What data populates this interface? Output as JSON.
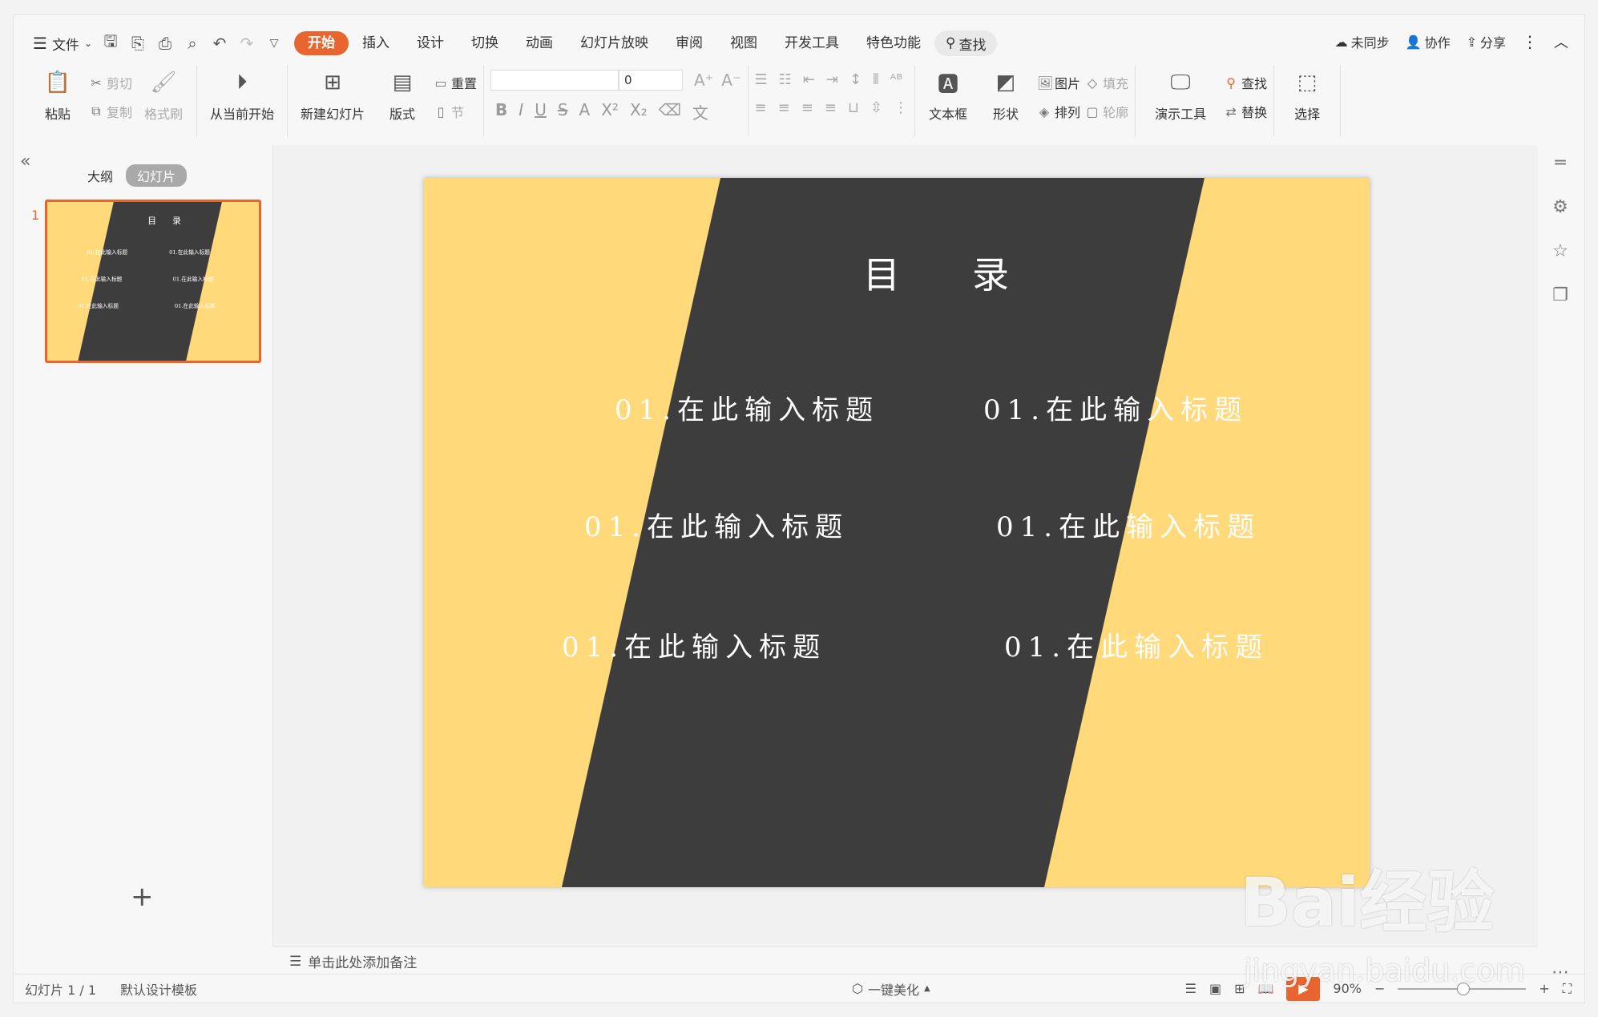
{
  "menu": {
    "file_label": "文件",
    "tabs": [
      "开始",
      "插入",
      "设计",
      "切换",
      "动画",
      "幻灯片放映",
      "审阅",
      "视图",
      "开发工具",
      "特色功能"
    ],
    "search_label": "查找",
    "right": {
      "sync": "未同步",
      "collab": "协作",
      "share": "分享"
    }
  },
  "ribbon": {
    "paste": "粘贴",
    "cut": "剪切",
    "copy": "复制",
    "format_painter": "格式刷",
    "from_current": "从当前开始",
    "new_slide": "新建幻灯片",
    "layout": "版式",
    "reset": "重置",
    "section": "节",
    "font_size": "0",
    "textbox": "文本框",
    "shape": "形状",
    "picture": "图片",
    "fill": "填充",
    "arrange": "排列",
    "outline": "轮廓",
    "present_tools": "演示工具",
    "find": "查找",
    "replace": "替换",
    "select": "选择"
  },
  "panel": {
    "tab_outline": "大纲",
    "tab_slides": "幻灯片",
    "slide_number": "1"
  },
  "slide": {
    "title": "目录",
    "entries": [
      "01.在此输入标题",
      "01.在此输入标题",
      "01.在此输入标题",
      "01.在此输入标题",
      "01.在此输入标题",
      "01.在此输入标题"
    ],
    "colors": {
      "background": "#FFD97A",
      "band": "#3D3D3D",
      "text": "#FFFFFF"
    }
  },
  "notes_placeholder": "单击此处添加备注",
  "status": {
    "slide_info": "幻灯片 1 / 1",
    "template": "默认设计模板",
    "beautify": "一键美化",
    "zoom": "90%"
  },
  "watermark": {
    "brand": "Bai经验",
    "url": "jingyan.baidu.com"
  }
}
